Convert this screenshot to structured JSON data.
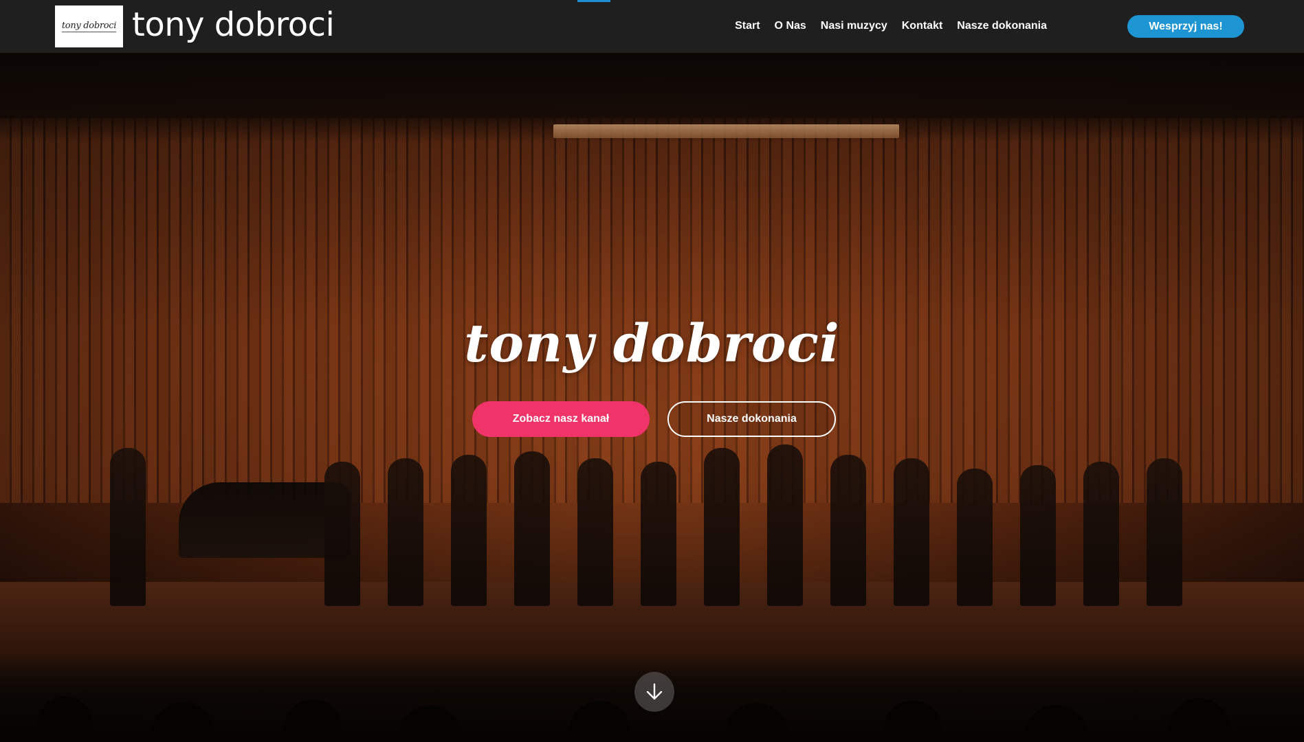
{
  "header": {
    "logo_text": "tony dobroci",
    "site_name": "tony dobroci",
    "nav": [
      {
        "label": "Start"
      },
      {
        "label": "O Nas"
      },
      {
        "label": "Nasi muzycy"
      },
      {
        "label": "Kontakt"
      },
      {
        "label": "Nasze dokonania"
      }
    ],
    "support_button": "Wesprzyj nas!"
  },
  "hero": {
    "title": "tony dobroci",
    "primary_button": "Zobacz nasz kanał",
    "secondary_button": "Nasze dokonania",
    "scroll_icon": "arrow-down-icon"
  },
  "colors": {
    "header_bg": "#1f1f1f",
    "accent_blue": "#1d95d3",
    "accent_pink": "#f0346a"
  }
}
